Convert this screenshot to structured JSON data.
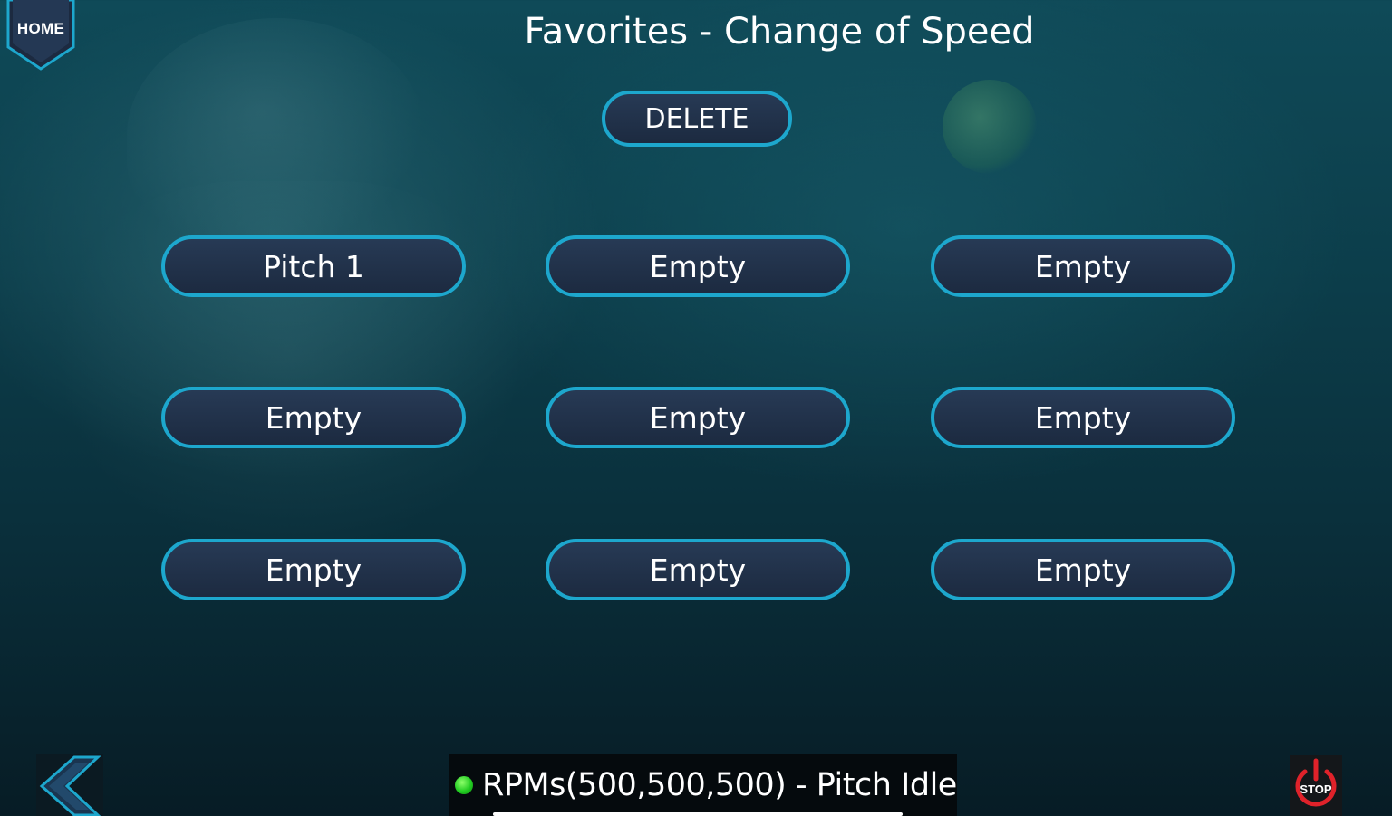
{
  "header": {
    "home_label": "HOME",
    "title": "Favorites - Change of Speed"
  },
  "actions": {
    "delete_label": "DELETE"
  },
  "favorites": {
    "slots": [
      {
        "label": "Pitch 1"
      },
      {
        "label": "Empty"
      },
      {
        "label": "Empty"
      },
      {
        "label": "Empty"
      },
      {
        "label": "Empty"
      },
      {
        "label": "Empty"
      },
      {
        "label": "Empty"
      },
      {
        "label": "Empty"
      },
      {
        "label": "Empty"
      }
    ]
  },
  "footer": {
    "status_text": "RPMs(500,500,500) - Pitch Idle",
    "status_color": "#22cc22",
    "stop_label": "STOP",
    "back_icon": "chevron-left-icon",
    "stop_icon": "power-icon"
  },
  "colors": {
    "accent": "#1da7cd",
    "button_fill": "#1c2a40",
    "stop_red": "#e0222a"
  }
}
